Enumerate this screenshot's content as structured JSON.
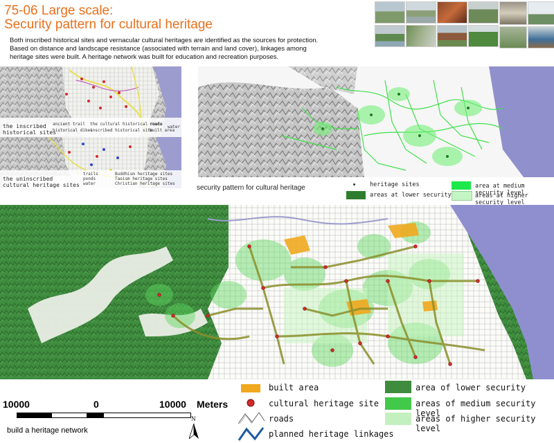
{
  "header": {
    "title_line1": "75-06 Large scale:",
    "title_line2": "Security pattern for cultural heritage",
    "description": "Both inscribed historical sites and vernacular cultural heritages are identified as the sources for protection. Based on distance and landscape resistance (associated with terrain and land cover), linkages among heritage sites were built. A heritage network was built for education and recreation purposes."
  },
  "inset_inscribed": {
    "label_line1": "the inscribed",
    "label_line2": "historical sites",
    "legend": [
      "ancient trail",
      "historical dikes",
      "the cultural historical route",
      "inscribed historical site",
      "roads",
      "built area",
      "water"
    ]
  },
  "inset_uninscribed": {
    "label_line1": "the uninscribed",
    "label_line2": "cultural heritage sites",
    "legend": [
      "trails",
      "ponds",
      "water",
      "Buddhism heritage sites",
      "Taoism heritage sites",
      "Christian heritage sites"
    ]
  },
  "security_pattern": {
    "caption": "security pattern for cultural heritage",
    "legend": {
      "heritage_sites": "heritage sites",
      "lower": "areas at lower security level",
      "medium": "area at medium security level",
      "higher": "areas at higher security level"
    }
  },
  "main_legend": {
    "built_area": "built area",
    "heritage_site": "cultural heritage site",
    "roads": "roads",
    "planned": "planned heritage linkages",
    "lower": "area of lower security",
    "medium": "areas of medium security level",
    "higher": "areas of higher security level"
  },
  "scale": {
    "left": "10000",
    "mid": "0",
    "right": "10000",
    "unit": "Meters",
    "north": "N"
  },
  "footer": {
    "caption": "build a heritage network"
  },
  "colors": {
    "title": "#e8701c",
    "lower": "#3f8c3f",
    "medium": "#42c94a",
    "higher": "#c4f0c0",
    "built": "#f0a81e",
    "linkage": "#1e5aa0",
    "sea": "#8f8fcf"
  }
}
